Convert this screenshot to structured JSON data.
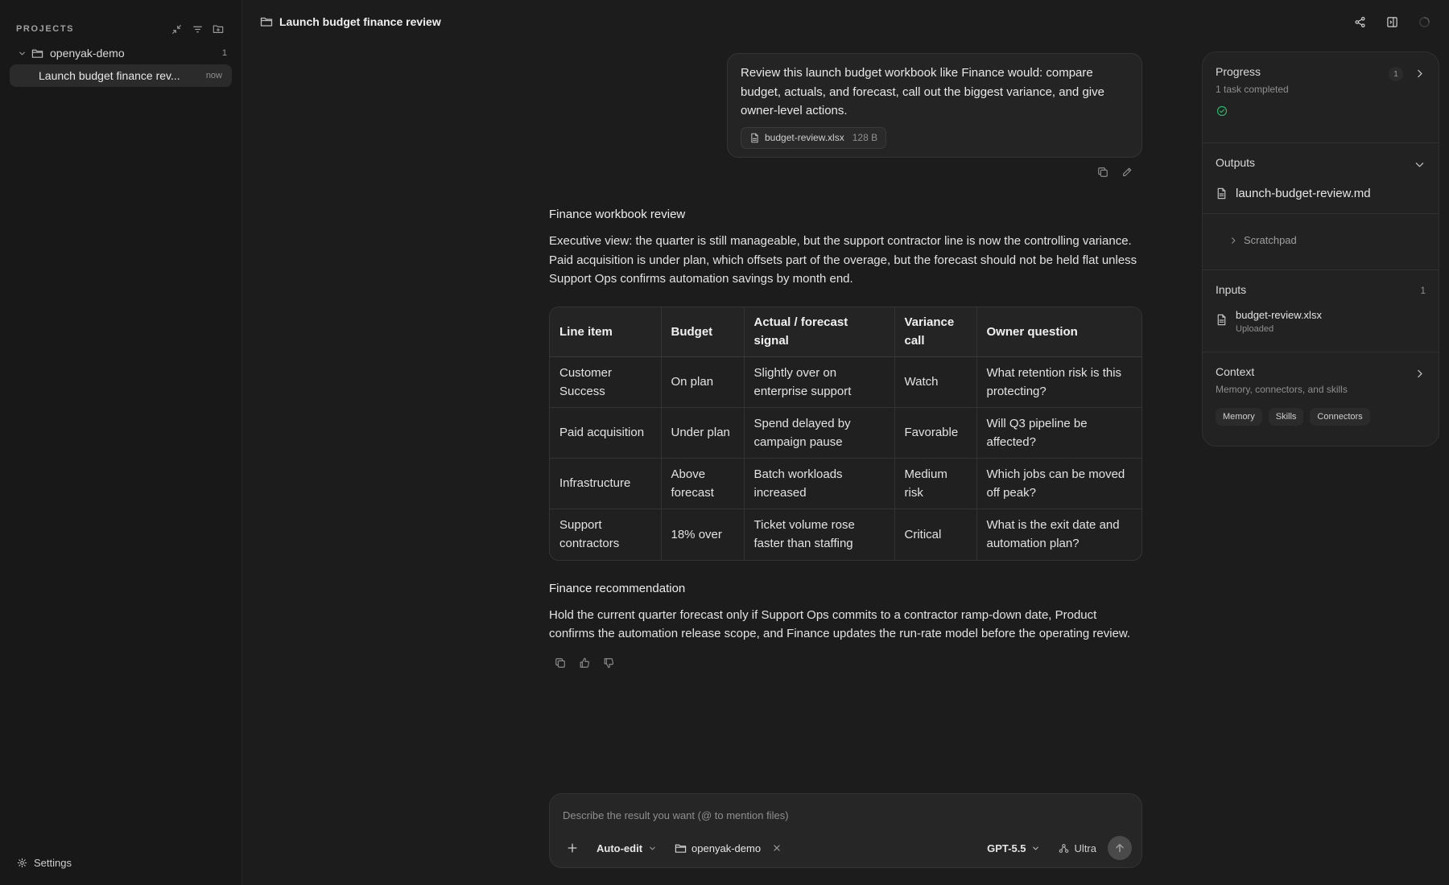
{
  "sidebar": {
    "projects_heading": "PROJECTS",
    "project": {
      "name": "openyak-demo",
      "count": "1"
    },
    "chat": {
      "title": "Launch budget finance rev...",
      "time": "now"
    },
    "settings_label": "Settings"
  },
  "topbar": {
    "title": "Launch budget finance review",
    "icons": [
      "share-icon",
      "panel-toggle-icon",
      "loading-spinner-icon"
    ]
  },
  "user_message": {
    "text": "Review this launch budget workbook like Finance would: compare budget, actuals, and forecast, call out the biggest variance, and give owner-level actions.",
    "attachment": {
      "name": "budget-review.xlsx",
      "size": "128 B"
    }
  },
  "reply": {
    "heading": "Finance workbook review",
    "executive": "Executive view: the quarter is still manageable, but the support contractor line is now the controlling variance. Paid acquisition is under plan, which offsets part of the overage, but the forecast should not be held flat unless Support Ops confirms automation savings by month end.",
    "table": {
      "headers": [
        "Line item",
        "Budget",
        "Actual / forecast signal",
        "Variance call",
        "Owner question"
      ],
      "rows": [
        [
          "Customer Success",
          "On plan",
          "Slightly over on enterprise support",
          "Watch",
          "What retention risk is this protecting?"
        ],
        [
          "Paid acquisition",
          "Under plan",
          "Spend delayed by campaign pause",
          "Favorable",
          "Will Q3 pipeline be affected?"
        ],
        [
          "Infrastructure",
          "Above forecast",
          "Batch workloads increased",
          "Medium risk",
          "Which jobs can be moved off peak?"
        ],
        [
          "Support contractors",
          "18% over",
          "Ticket volume rose faster than staffing",
          "Critical",
          "What is the exit date and automation plan?"
        ]
      ]
    },
    "recommendation_heading": "Finance recommendation",
    "recommendation": "Hold the current quarter forecast only if Support Ops commits to a contractor ramp-down date, Product confirms the automation release scope, and Finance updates the run-rate model before the operating review."
  },
  "right_panel": {
    "progress": {
      "title": "Progress",
      "badge": "1",
      "subtitle": "1 task completed"
    },
    "outputs": {
      "title": "Outputs",
      "file": "launch-budget-review.md",
      "scratchpad": "Scratchpad"
    },
    "inputs": {
      "title": "Inputs",
      "count": "1",
      "file": "budget-review.xlsx",
      "status": "Uploaded"
    },
    "context": {
      "title": "Context",
      "subtitle": "Memory, connectors, and skills",
      "chips": [
        "Memory",
        "Skills",
        "Connectors"
      ]
    }
  },
  "composer": {
    "placeholder": "Describe the result you want (@ to mention files)",
    "mode": "Auto-edit",
    "project": "openyak-demo",
    "model": "GPT-5.5",
    "effort": "Ultra"
  },
  "colors": {
    "background": "#1c1c1c",
    "sidebar": "#181818",
    "success": "#2bb36b"
  }
}
